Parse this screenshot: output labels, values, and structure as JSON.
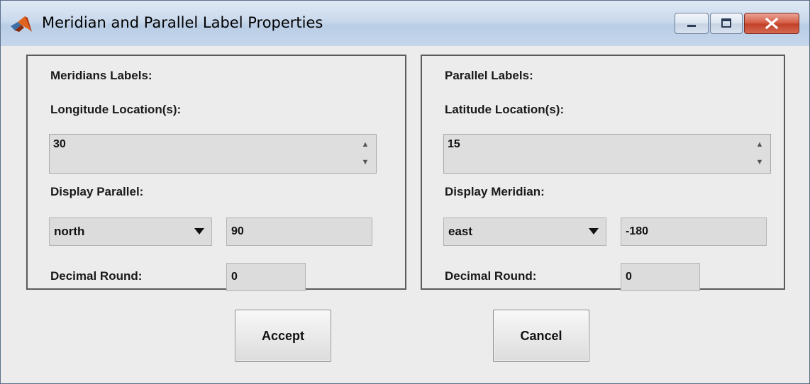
{
  "window": {
    "title": "Meridian and Parallel Label Properties",
    "controls": [
      "minimize",
      "maximize",
      "close"
    ]
  },
  "meridians": {
    "section_label": "Meridians Labels:",
    "location_label": "Longitude Location(s):",
    "location_value": "30",
    "display_label": "Display Parallel:",
    "display_selected": "north",
    "display_value": "90",
    "round_label": "Decimal Round:",
    "round_value": "0"
  },
  "parallels": {
    "section_label": "Parallel Labels:",
    "location_label": "Latitude Location(s):",
    "location_value": "15",
    "display_label": "Display Meridian:",
    "display_selected": "east",
    "display_value": "-180",
    "round_label": "Decimal Round:",
    "round_value": "0"
  },
  "buttons": {
    "accept": "Accept",
    "cancel": "Cancel"
  },
  "icons": {
    "app": "matlab-logo-icon",
    "spin_up": "spin-up-arrow",
    "spin_down": "spin-down-arrow",
    "dropdown": "chevron-down-icon"
  },
  "colors": {
    "titlebar": "#c9d9ec",
    "close_button": "#c2412a",
    "panel_background": "#ececec"
  }
}
